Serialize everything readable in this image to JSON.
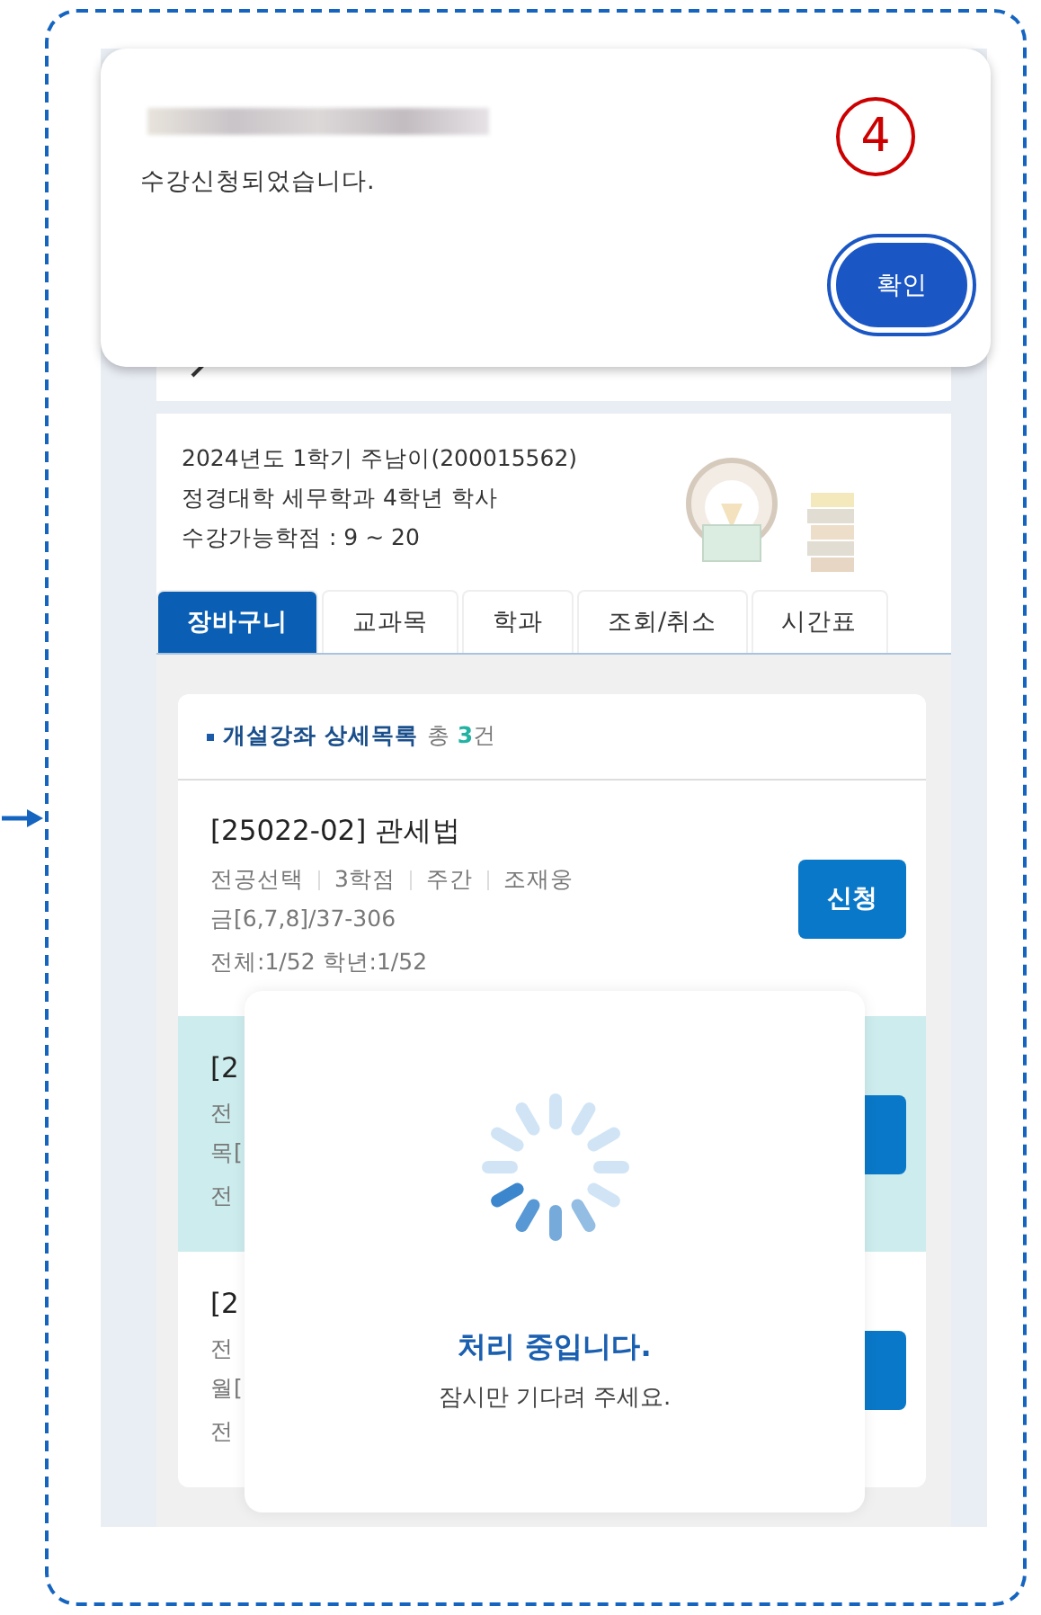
{
  "alert": {
    "message": "수강신청되었습니다.",
    "annotation": "4",
    "confirm": "확인"
  },
  "student": {
    "lines": [
      "2024년도 1학기 주남이(200015562)",
      "정경대학 세무학과 4학년 학사",
      "수강가능학점 : 9 ~ 20"
    ]
  },
  "tabs": [
    {
      "label": "장바구니",
      "selected": true
    },
    {
      "label": "교과목",
      "selected": false
    },
    {
      "label": "학과",
      "selected": false
    },
    {
      "label": "조회/취소",
      "selected": false
    },
    {
      "label": "시간표",
      "selected": false
    }
  ],
  "list": {
    "title": "개설강좌 상세목록",
    "total_prefix": "총",
    "total_count": "3",
    "total_suffix": "건"
  },
  "courses": [
    {
      "title": "[25022-02] 관세법",
      "meta": [
        "전공선택",
        "3학점",
        "주간",
        "조재웅"
      ],
      "schedule": "금[6,7,8]/37-306",
      "enrollment": "전체:1/52 학년:1/52",
      "button": "신청",
      "highlighted": false
    },
    {
      "title": "[2",
      "meta": [
        "전"
      ],
      "schedule": "목[",
      "enrollment": "전",
      "highlighted": true
    },
    {
      "title": "[2",
      "meta": [
        "전"
      ],
      "schedule": "월[",
      "enrollment": "전",
      "highlighted": false
    }
  ],
  "loading": {
    "title": "처리 중입니다.",
    "message": "잠시만 기다려 주세요."
  }
}
